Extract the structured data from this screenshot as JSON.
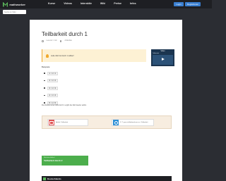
{
  "header": {
    "logo_text": "mathworker",
    "nav": [
      "Kurse",
      "Videos",
      "Interaktiv",
      "Wiki",
      "Preise",
      "Infos"
    ],
    "login_label": "Login",
    "register_label": "Registrieren"
  },
  "search": {
    "placeholder": "Suche im Wiki"
  },
  "article": {
    "title": "Teilbarkeit durch 1",
    "meta": [
      "Lesezeit: 1 min",
      "Artikelliste"
    ],
    "infobox": "Jede Zahl ist durch 1 teilbar!",
    "examples_heading": "Beispiele:",
    "examples": [
      "1 : 1 = 1",
      "2 : 1 = 2",
      "3 : 1 = 3",
      "4 : 1 = 4",
      "5 : 1 = 5"
    ],
    "conclusion": "Die Division einer Zahl durch 1 ergibt die Zahl wieder selbst."
  },
  "video": {
    "title": "Video",
    "subtitle": "Teilbarkeit"
  },
  "related_links": [
    {
      "label": "Artikel: Teilbarkeit",
      "icon": "document-icon"
    },
    {
      "label": "3 / 7 ganz du Aufmerksam zu: Teilbarkeit",
      "icon": "lightbulb-icon"
    }
  ],
  "next": {
    "small": "Nächster Artikel",
    "label": "Teilbarkeit durch 2"
  },
  "footer": {
    "text": "Deutschlands"
  },
  "colors": {
    "brand": "#5cb85c",
    "accent": "#3a7fd1",
    "info": "#f0a92e"
  }
}
